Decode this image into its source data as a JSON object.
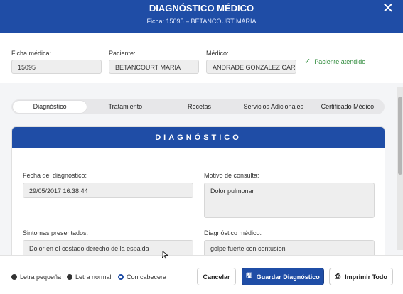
{
  "window": {
    "title": "DIAGNÓSTICO MÉDICO",
    "subtitle": "Ficha: 15095 – BETANCOURT MARIA",
    "close_glyph": "✕"
  },
  "header": {
    "ficha": {
      "label": "Ficha médica:",
      "value": "15095"
    },
    "paciente": {
      "label": "Paciente:",
      "value": "BETANCOURT MARIA"
    },
    "medico": {
      "label": "Médico:",
      "value": "ANDRADE GONZALEZ CARL"
    },
    "status": {
      "icon": "check-icon",
      "text": "Paciente atendido",
      "color": "#2d8a3a"
    }
  },
  "tabs": [
    {
      "label": "Diagnóstico",
      "active": true
    },
    {
      "label": "Tratamiento",
      "active": false
    },
    {
      "label": "Recetas",
      "active": false
    },
    {
      "label": "Servicios Adicionales",
      "active": false
    },
    {
      "label": "Certificado Médico",
      "active": false
    }
  ],
  "card": {
    "heading": "DIAGNÓSTICO",
    "fecha": {
      "label": "Fecha del diagnóstico:",
      "value": "29/05/2017 16:38:44"
    },
    "motivo": {
      "label": "Motivo de consulta:",
      "value": "Dolor pulmonar"
    },
    "sintomas": {
      "label": "Sintomas presentados:",
      "value": "Dolor en el costado derecho de la espalda"
    },
    "diagnostico": {
      "label": "Diagnóstico médico:",
      "value": "golpe fuerte con contusion"
    }
  },
  "footer": {
    "options": [
      {
        "label": "Letra pequeña",
        "selected": false
      },
      {
        "label": "Letra normal",
        "selected": false
      },
      {
        "label": "Con cabecera",
        "selected": true
      }
    ],
    "cancel_label": "Cancelar",
    "save_label": "Guardar Diagnóstico",
    "print_label": "Imprimir Todo",
    "save_icon": "floppy-disk-icon",
    "print_icon": "printer-icon"
  },
  "colors": {
    "accent": "#1f4da6",
    "success": "#2d8a3a"
  }
}
